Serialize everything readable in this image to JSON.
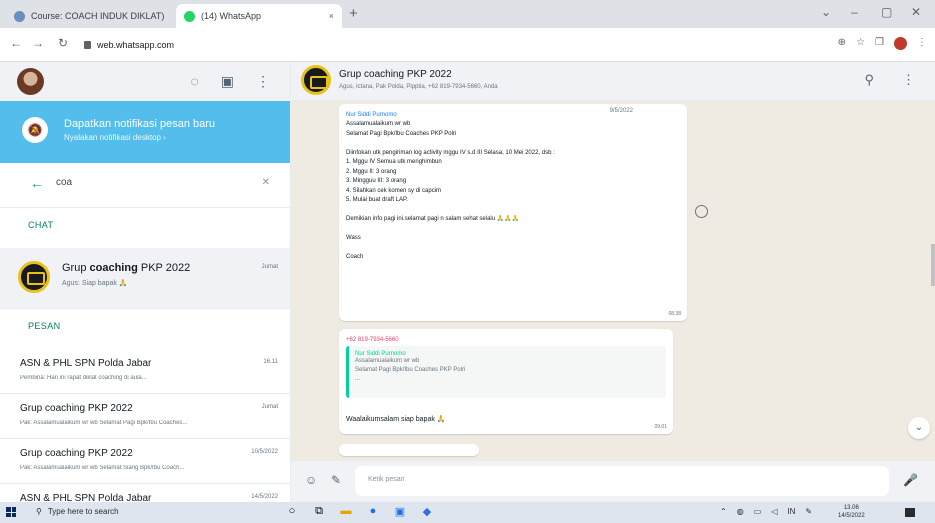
{
  "browser": {
    "tab_inactive": "Course: COACH INDUK DIKLAT) ×",
    "tab_active": "(14) WhatsApp",
    "url": "web.whatsapp.com"
  },
  "left_pane": {
    "notification": {
      "title": "Dapatkan notifikasi pesan baru",
      "subtitle": "Nyalakan notifikasi desktop ›"
    },
    "search_query": "coa",
    "chat_section_label": "CHAT",
    "chat": {
      "name_prefix": "Grup ",
      "name_match": "coaching",
      "name_suffix": " PKP 2022",
      "time": "Jumat",
      "preview": "Agus: Siap bapak 🙏"
    },
    "messages_section_label": "PESAN",
    "messages": [
      {
        "name": "ASN & PHL SPN Polda Jabar",
        "time": "16.11",
        "preview": "Pembina: Hari ini rapat diklat coaching di aula..."
      },
      {
        "name": "Grup coaching PKP 2022",
        "time": "Jumat",
        "preview": "Pak: Assalamualaikum wr wb Selamat Pagi Bpk/Ibu Coaches..."
      },
      {
        "name": "Grup coaching PKP 2022",
        "time": "10/5/2022",
        "preview": "Pak: Assalamualaikum wr wb Selamat Siang Bpk/Ibu Coach..."
      },
      {
        "name": "ASN & PHL SPN Polda Jabar",
        "time": "14/5/2022",
        "preview": ""
      }
    ]
  },
  "chat_header": {
    "title": "Grup coaching PKP 2022",
    "members": "Agus, Ictana, Pak Polda, Pipptia, +62 819-7934-5660, Anda"
  },
  "messages": [
    {
      "sender": "Nur Siddi Purnomo",
      "date": "9/5/2022",
      "lines": [
        "Assalamualaikum wr wb",
        "Selamat Pagi Bpk/Ibu Coaches PKP Polri",
        "",
        "Diinfokan utk pengiriman log activity mggu IV s.d III Selasa, 10 Mei 2022, dsb :",
        "1. Mggu IV Semua utk menghimbun",
        "2. Mggu II: 3 orang",
        "3. Mingguu III: 3 orang",
        "4. Silahkan cek komen sy di capcim",
        "5. Mulai buat draft LAP.",
        "",
        "Demikian info pagi ini.selamat pagi n salam sehat selalu 🙏🙏🙏",
        "",
        "Wass",
        "",
        "Coach"
      ],
      "time": "08.38"
    },
    {
      "sender": "+62 819-7934-5660",
      "quote_sender": "Nur Siddi Purnomo",
      "quote_lines": [
        "Assalamualaikum wr wb",
        "Selamat Pagi Bpk/Ibu Coaches PKP Polri",
        "..."
      ],
      "text": "Waalaikumsalam siap bapak 🙏",
      "time": "09.01"
    }
  ],
  "composer_placeholder": "Ketik pesan",
  "taskbar": {
    "search": "Type here to search",
    "time": "13.06",
    "date": "14/5/2022"
  }
}
